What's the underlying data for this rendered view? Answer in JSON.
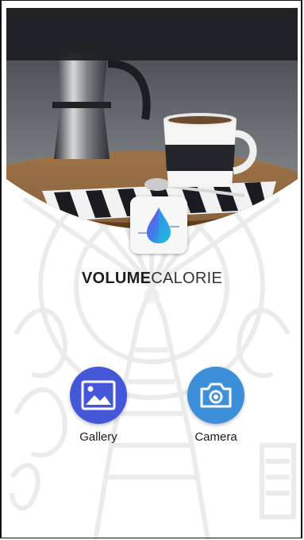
{
  "app": {
    "name_bold": "VOLUME",
    "name_light": "CALORIE"
  },
  "actions": {
    "gallery_label": "Gallery",
    "camera_label": "Camera"
  },
  "colors": {
    "gallery": "#4457d8",
    "camera": "#3d8fd9",
    "status_bar": "#1e2024"
  },
  "icons": {
    "logo": "water-drop-icon",
    "gallery": "image-icon",
    "camera": "camera-icon"
  }
}
